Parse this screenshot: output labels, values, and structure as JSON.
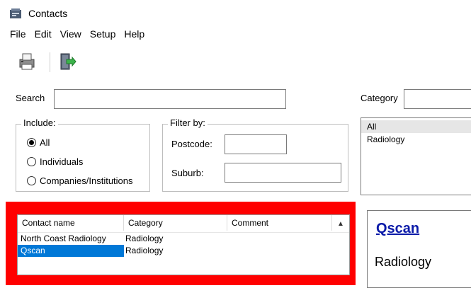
{
  "window": {
    "title": "Contacts",
    "app_icon": "contacts-app-icon"
  },
  "menu": {
    "items": [
      "File",
      "Edit",
      "View",
      "Setup",
      "Help"
    ]
  },
  "toolbar": {
    "buttons": [
      {
        "icon": "print-icon"
      },
      {
        "icon": "exit-door-icon"
      }
    ]
  },
  "search": {
    "label": "Search",
    "value": ""
  },
  "category": {
    "label": "Category",
    "value": "",
    "list": [
      "All",
      "Radiology"
    ],
    "selected": "All"
  },
  "include": {
    "title": "Include:",
    "options": [
      "All",
      "Individuals",
      "Companies/Institutions"
    ],
    "selected": "All"
  },
  "filter": {
    "title": "Filter by:",
    "postcode_label": "Postcode:",
    "postcode_value": "",
    "suburb_label": "Suburb:",
    "suburb_value": ""
  },
  "contacts": {
    "columns": [
      "Contact name",
      "Category",
      "Comment"
    ],
    "rows": [
      {
        "name": "North Coast Radiology",
        "category": "Radiology",
        "comment": ""
      },
      {
        "name": "Qscan",
        "category": "Radiology",
        "comment": ""
      }
    ],
    "selected_row": 1
  },
  "detail": {
    "name": "Qscan",
    "category": "Radiology"
  },
  "colors": {
    "highlight": "#ff0000",
    "selection": "#0078d7",
    "link": "#0a1aa8"
  }
}
